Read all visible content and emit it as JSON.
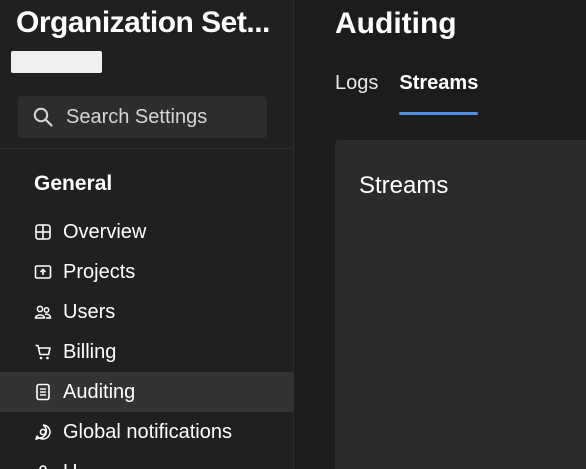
{
  "sidebar": {
    "org_title": "Organization Set...",
    "search": {
      "label": "Search Settings",
      "icon": "search-icon"
    },
    "section_heading": "General",
    "items": [
      {
        "label": "Overview",
        "icon": "overview-icon"
      },
      {
        "label": "Projects",
        "icon": "projects-icon"
      },
      {
        "label": "Users",
        "icon": "users-icon"
      },
      {
        "label": "Billing",
        "icon": "cart-icon"
      },
      {
        "label": "Auditing",
        "icon": "auditing-icon",
        "selected": true
      },
      {
        "label": "Global notifications",
        "icon": "notifications-icon"
      },
      {
        "label": "U...",
        "icon": "user-icon"
      }
    ]
  },
  "main": {
    "page_title": "Auditing",
    "tabs": [
      {
        "label": "Logs",
        "active": false
      },
      {
        "label": "Streams",
        "active": true
      }
    ],
    "panel_title": "Streams"
  },
  "colors": {
    "accent": "#4f8fe0",
    "background": "#1c1c1c",
    "sidebar": "#202020",
    "selected": "#333333",
    "panel": "#2b2b2b"
  }
}
